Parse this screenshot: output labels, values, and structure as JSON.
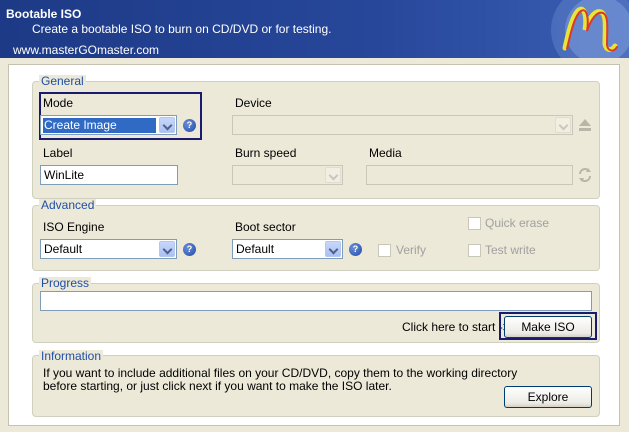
{
  "banner": {
    "title": "Bootable ISO",
    "subtitle": "Create a bootable ISO to burn on CD/DVD or for testing.",
    "site": "www.masterGOmaster.com"
  },
  "general": {
    "legend": "General",
    "mode_label": "Mode",
    "mode_value": "Create Image",
    "device_label": "Device",
    "device_value": "",
    "label_label": "Label",
    "label_value": "WinLite",
    "burn_speed_label": "Burn speed",
    "burn_speed_value": "",
    "media_label": "Media",
    "media_value": ""
  },
  "advanced": {
    "legend": "Advanced",
    "iso_engine_label": "ISO Engine",
    "iso_engine_value": "Default",
    "boot_sector_label": "Boot sector",
    "boot_sector_value": "Default",
    "verify_label": "Verify",
    "quick_erase_label": "Quick erase",
    "test_write_label": "Test write"
  },
  "progress": {
    "legend": "Progress",
    "start_hint": "Click here to start ->",
    "make_iso_label": "Make ISO"
  },
  "information": {
    "legend": "Information",
    "text_line1": "If you want to include additional files on your CD/DVD, copy them to the working directory",
    "text_line2": "before starting, or just click next if you want to make the ISO later.",
    "explore_label": "Explore"
  },
  "help_glyph": "?",
  "colors": {
    "banner": "#1d3a86",
    "legend": "#1f4ea8",
    "selection": "#316ac5",
    "highlight_box": "#1a1a6e"
  }
}
